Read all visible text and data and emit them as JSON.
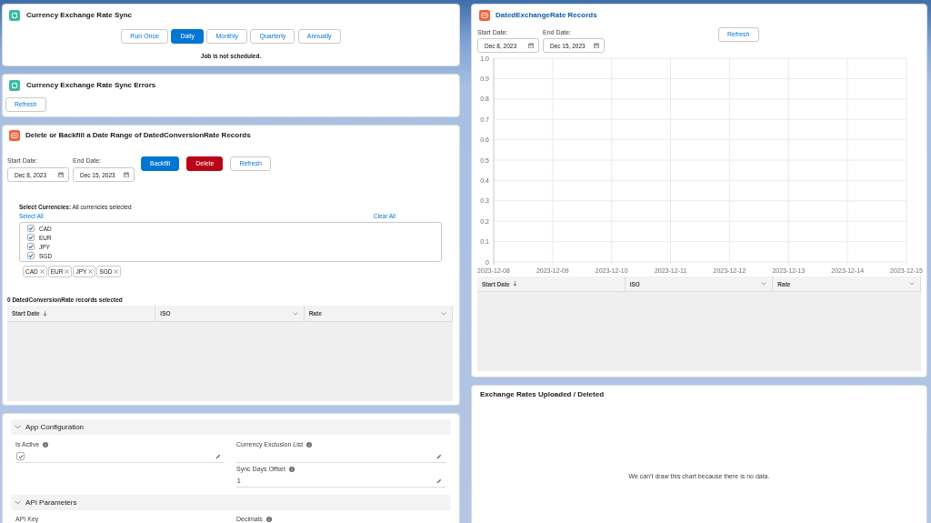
{
  "sync_card": {
    "title": "Currency Exchange Rate Sync",
    "schedule_buttons": [
      {
        "label": "Run Once",
        "selected": false
      },
      {
        "label": "Daily",
        "selected": true
      },
      {
        "label": "Monthly",
        "selected": false
      },
      {
        "label": "Quarterly",
        "selected": false
      },
      {
        "label": "Annually",
        "selected": false
      }
    ],
    "status": "Job is not scheduled."
  },
  "errors_card": {
    "title": "Currency Exchange Rate Sync Errors",
    "buttons": [
      {
        "label": "Refresh",
        "kind": "neutral"
      }
    ]
  },
  "range_card": {
    "title": "Delete or Backfill a Date Range of DatedConversionRate Records",
    "date_fields": [
      {
        "label": "Start Date:",
        "value": "Dec 8, 2023"
      },
      {
        "label": "End Date:",
        "value": "Dec 15, 2023"
      }
    ],
    "buttons": [
      {
        "label": "Backfill",
        "kind": "brand"
      },
      {
        "label": "Delete",
        "kind": "destructive"
      },
      {
        "label": "Refresh",
        "kind": "neutral"
      }
    ],
    "currency_picker": {
      "label": "**Select Currencies:** All currencies selected",
      "select_all": "Select All",
      "clear_all": "Clear All",
      "options": [
        {
          "label": "CAD",
          "checked": true
        },
        {
          "label": "EUR",
          "checked": true
        },
        {
          "label": "JPY",
          "checked": true
        },
        {
          "label": "SGD",
          "checked": true
        }
      ],
      "pills": [
        "CAD",
        "EUR",
        "JPY",
        "SGD"
      ]
    },
    "selection_count": "0 DatedConversionRate records selected",
    "table": {
      "columns": [
        {
          "label": "Start Date",
          "sorted": true,
          "menu": false
        },
        {
          "label": "ISO",
          "sorted": false,
          "menu": true
        },
        {
          "label": "Rate",
          "sorted": false,
          "menu": true
        }
      ]
    }
  },
  "config_card": {
    "sections": [
      {
        "title": "App Configuration",
        "expanded": true,
        "columns": [
          {
            "fields": [
              {
                "label": "Is Active",
                "info": true,
                "kind": "checkbox",
                "checked": true
              }
            ]
          },
          {
            "fields": [
              {
                "label": "Currency Exclusion List",
                "info": true,
                "kind": "text"
              },
              {
                "label": "Sync Days Offset",
                "info": true,
                "kind": "text",
                "value": "1"
              }
            ]
          }
        ]
      },
      {
        "title": "API Parameters",
        "expanded": true,
        "columns": [
          {
            "fields": [
              {
                "label": "API Key",
                "info": false
              }
            ]
          },
          {
            "fields": [
              {
                "label": "Decimals",
                "info": true
              }
            ]
          }
        ]
      }
    ]
  },
  "records_card": {
    "title": "DatedExchangeRate Records",
    "date_fields": [
      {
        "label": "Start Date:",
        "value": "Dec 8, 2023"
      },
      {
        "label": "End Date:",
        "value": "Dec 15, 2023"
      }
    ],
    "buttons": [
      {
        "label": "Refresh",
        "kind": "neutral"
      }
    ],
    "chart_data": {
      "type": "line",
      "grid": true,
      "categories": [
        "2023-12-08",
        "2023-12-09",
        "2023-12-10",
        "2023-12-11",
        "2023-12-12",
        "2023-12-13",
        "2023-12-14",
        "2023-12-15"
      ],
      "ylim": [
        0,
        1
      ],
      "yticks": [
        0,
        0.1,
        0.2,
        0.3,
        0.4,
        0.5,
        0.6,
        0.7,
        0.8,
        0.9,
        {
          "value": 1,
          "label": "1.0"
        }
      ]
    },
    "table": {
      "columns": [
        {
          "label": "Start Date",
          "sorted": true,
          "menu": false
        },
        {
          "label": "ISO",
          "sorted": false,
          "menu": true
        },
        {
          "label": "Rate",
          "sorted": false,
          "menu": true
        }
      ]
    }
  },
  "uploads_card": {
    "title": "Exchange Rates Uploaded / Deleted",
    "empty_message": "We can't draw this chart because there is no data."
  }
}
